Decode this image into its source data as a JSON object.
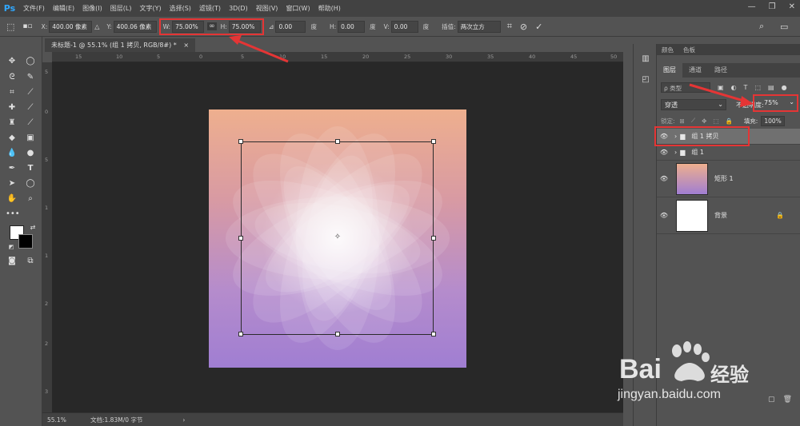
{
  "app": {
    "logo": "Ps"
  },
  "menu": [
    "文件(F)",
    "编辑(E)",
    "图像(I)",
    "图层(L)",
    "文字(Y)",
    "选择(S)",
    "滤镜(T)",
    "3D(D)",
    "视图(V)",
    "窗口(W)",
    "帮助(H)"
  ],
  "window_controls": {
    "minimize": "—",
    "restore": "❐",
    "close": "✕"
  },
  "options": {
    "x_label": "X:",
    "x_value": "400.00 像素",
    "y_label": "Y:",
    "y_value": "400.06 像素",
    "w_label": "W:",
    "w_value": "75.00%",
    "h_label": "H:",
    "h_value": "75.00%",
    "angle_value": "0.00",
    "angle_unit": "度",
    "hskew_label": "H:",
    "hskew_value": "0.00",
    "hskew_unit": "度",
    "vskew_label": "V:",
    "vskew_value": "0.00",
    "vskew_unit": "度",
    "interp_label": "插值:",
    "interp_value": "两次立方",
    "cancel_icon": "cancel-transform-icon",
    "commit_icon": "commit-transform-icon"
  },
  "document": {
    "tab_title": "未标题-1 @ 55.1% (组 1 拷贝, RGB/8#) *",
    "tab_close": "×",
    "ruler_top": [
      "15",
      "10",
      "5",
      "0",
      "5",
      "10",
      "15",
      "20",
      "25",
      "30",
      "35",
      "40",
      "45",
      "50"
    ],
    "ruler_left": [
      "5",
      "0",
      "5",
      "1",
      "1",
      "2",
      "2",
      "3"
    ]
  },
  "status": {
    "zoom": "55.1%",
    "doc_info": "文档:1.83M/0 字节",
    "arrow": "›"
  },
  "panel": {
    "top_tabs": [
      "颜色",
      "色板"
    ],
    "tabs": [
      "图层",
      "通道",
      "路径"
    ],
    "filter_label": "ρ 类型",
    "blend_mode": "穿透",
    "opacity_label": "不透明度:",
    "opacity_value": "75%",
    "lock_label": "锁定:",
    "fill_label": "填充:",
    "fill_value": "100%",
    "layers": [
      {
        "name": "组 1 拷贝",
        "type": "group",
        "selected": true
      },
      {
        "name": "组 1",
        "type": "group",
        "selected": false
      },
      {
        "name": "矩形 1",
        "type": "shape",
        "selected": false
      },
      {
        "name": "背景",
        "type": "background",
        "selected": false
      }
    ]
  },
  "watermark": {
    "brand": "Bai",
    "brand2": "经验",
    "url": "jingyan.baidu.com"
  },
  "colors": {
    "highlight": "#e53535",
    "ps_blue": "#31a8ff"
  }
}
